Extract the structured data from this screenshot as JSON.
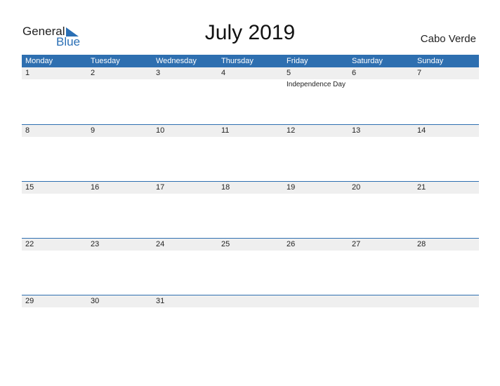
{
  "logo": {
    "general": "General",
    "blue": "Blue"
  },
  "title": "July 2019",
  "country": "Cabo Verde",
  "weekdays": [
    "Monday",
    "Tuesday",
    "Wednesday",
    "Thursday",
    "Friday",
    "Saturday",
    "Sunday"
  ],
  "weeks": [
    [
      "1",
      "2",
      "3",
      "4",
      "5",
      "6",
      "7"
    ],
    [
      "8",
      "9",
      "10",
      "11",
      "12",
      "13",
      "14"
    ],
    [
      "15",
      "16",
      "17",
      "18",
      "19",
      "20",
      "21"
    ],
    [
      "22",
      "23",
      "24",
      "25",
      "26",
      "27",
      "28"
    ],
    [
      "29",
      "30",
      "31",
      "",
      "",
      "",
      ""
    ]
  ],
  "events": {
    "0-4": "Independence Day"
  },
  "colors": {
    "accent": "#2e6fb0",
    "date_strip": "#efefef"
  }
}
